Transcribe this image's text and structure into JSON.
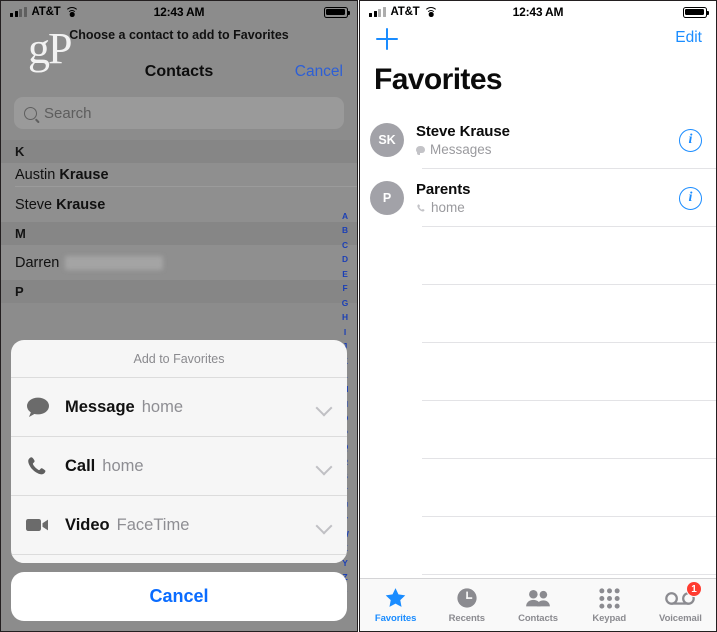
{
  "status_bar": {
    "carrier": "AT&T",
    "time": "12:43 AM",
    "signal_icon": "cellular-bars-icon",
    "wifi_icon": "wifi-icon",
    "battery_icon": "battery-full-icon"
  },
  "left_panel": {
    "watermark": "gP",
    "subtitle": "Choose a contact to add to Favorites",
    "nav_title": "Contacts",
    "cancel_label": "Cancel",
    "search": {
      "placeholder": "Search",
      "value": "",
      "icon": "search-icon"
    },
    "list": [
      {
        "type": "section",
        "label": "K"
      },
      {
        "type": "contact",
        "first": "Austin",
        "last": "Krause",
        "redacted": false
      },
      {
        "type": "contact",
        "first": "Steve",
        "last": "Krause",
        "redacted": false
      },
      {
        "type": "section",
        "label": "M"
      },
      {
        "type": "contact",
        "first": "Darren",
        "last": "",
        "redacted": true
      },
      {
        "type": "section",
        "label": "P"
      }
    ],
    "alpha_index": [
      "A",
      "B",
      "C",
      "D",
      "E",
      "F",
      "G",
      "H",
      "I",
      "J",
      "K",
      "L",
      "M",
      "N",
      "O",
      "P",
      "Q",
      "R",
      "S",
      "T",
      "U",
      "V",
      "W",
      "X",
      "Y",
      "Z",
      "#"
    ],
    "action_sheet": {
      "title": "Add to Favorites",
      "options": [
        {
          "label": "Message",
          "value": "home",
          "icon": "message-bubble-icon",
          "chevron": "chevron-down-icon"
        },
        {
          "label": "Call",
          "value": "home",
          "icon": "phone-icon",
          "chevron": "chevron-down-icon"
        },
        {
          "label": "Video",
          "value": "FaceTime",
          "icon": "video-camera-icon",
          "chevron": "chevron-down-icon"
        }
      ],
      "cancel_label": "Cancel"
    }
  },
  "right_panel": {
    "add_icon": "plus-icon",
    "edit_label": "Edit",
    "title": "Favorites",
    "favorites": [
      {
        "initials": "SK",
        "name": "Steve Krause",
        "subtitle": "Messages",
        "sub_icon": "message-bubble-icon",
        "info_icon": "info-circle-icon"
      },
      {
        "initials": "P",
        "name": "Parents",
        "subtitle": "home",
        "sub_icon": "phone-icon",
        "info_icon": "info-circle-icon"
      }
    ],
    "empty_row_count": 7,
    "tabs": [
      {
        "label": "Favorites",
        "icon": "star-icon",
        "active": true,
        "badge": ""
      },
      {
        "label": "Recents",
        "icon": "clock-icon",
        "active": false,
        "badge": ""
      },
      {
        "label": "Contacts",
        "icon": "people-icon",
        "active": false,
        "badge": ""
      },
      {
        "label": "Keypad",
        "icon": "keypad-grid-icon",
        "active": false,
        "badge": ""
      },
      {
        "label": "Voicemail",
        "icon": "voicemail-icon",
        "active": false,
        "badge": "1"
      }
    ]
  },
  "colors": {
    "accent_blue": "#1a8cff",
    "link_blue": "#2d5fd6",
    "badge_red": "#ff3b30",
    "dim_overlay": "#8c8c8c",
    "avatar_gray": "#a2a2a8"
  }
}
